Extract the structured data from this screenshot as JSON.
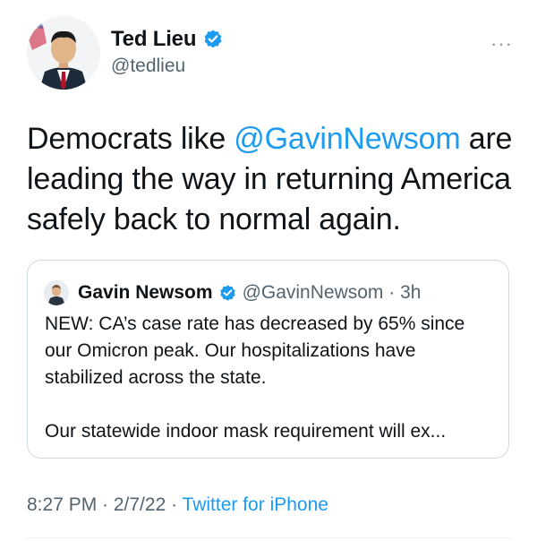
{
  "author": {
    "display_name": "Ted Lieu",
    "handle": "@tedlieu",
    "verified_icon": "verified-badge-icon",
    "accent": "#1d9bf0"
  },
  "tweet": {
    "text_before": "Democrats like ",
    "mention": "@GavinNewsom",
    "text_after": " are leading the way in returning America safely back to normal again."
  },
  "quoted_tweet": {
    "display_name": "Gavin Newsom",
    "handle_time": "@GavinNewsom · 3h",
    "paragraph1": "NEW: CA’s case rate has decreased by 65% since our Omicron peak. Our hospitalizations have stabilized across the state.",
    "paragraph2": "Our statewide indoor mask requirement will ex..."
  },
  "footer": {
    "timestamp": "8:27 PM · 2/7/22 · ",
    "source": "Twitter for iPhone"
  },
  "more_label": "···"
}
